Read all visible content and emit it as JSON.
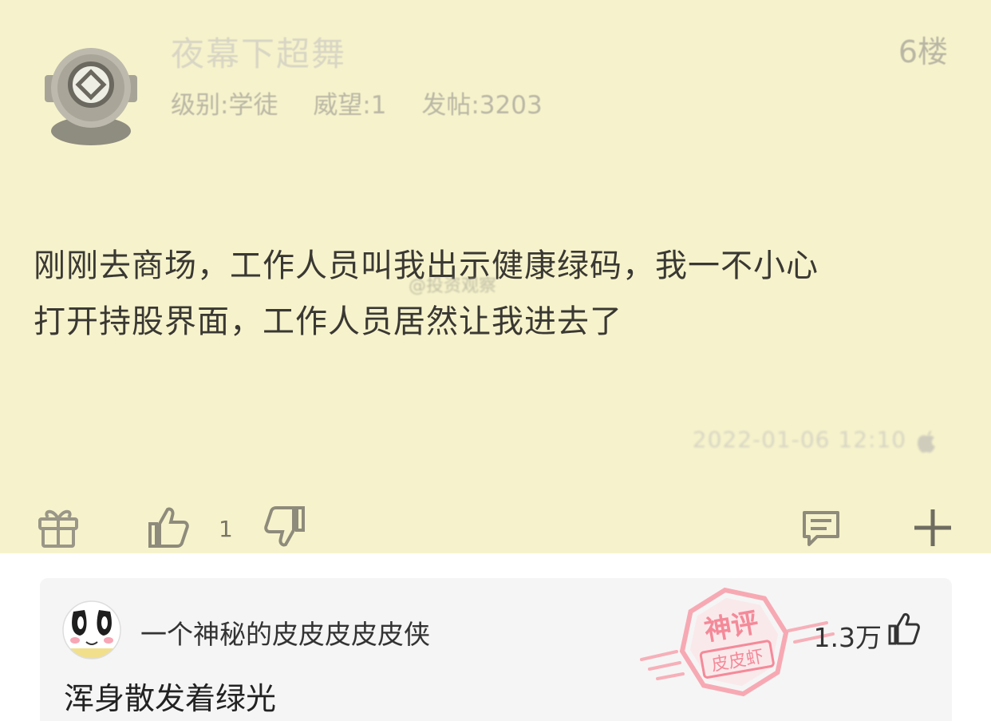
{
  "post": {
    "username": "夜幕下超舞",
    "floor": "6楼",
    "meta": {
      "level": "级别:学徒",
      "reputation": "威望:1",
      "posts": "发帖:3203"
    },
    "body_line1": "刚刚去商场，工作人员叫我出示健康绿码，我一不小心",
    "body_line2": "打开持股界面，工作人员居然让我进去了",
    "watermark": "@投资观察",
    "timestamp": "2022-01-06 12:10",
    "like_count": "1",
    "colors": {
      "background": "#f6f3cc",
      "text": "#3a3833"
    },
    "toolbar_icons": [
      "gift-icon",
      "thumbs-up-icon",
      "thumbs-down-icon",
      "comment-icon",
      "plus-icon"
    ]
  },
  "comment": {
    "author": "一个神秘的皮皮皮皮皮侠",
    "text": "浑身散发着绿光",
    "likes": "1.3万",
    "stamp_top": "神评",
    "stamp_bottom": "皮皮虾",
    "colors": {
      "card": "#f5f5f5",
      "stamp": "#f26b7a"
    }
  }
}
